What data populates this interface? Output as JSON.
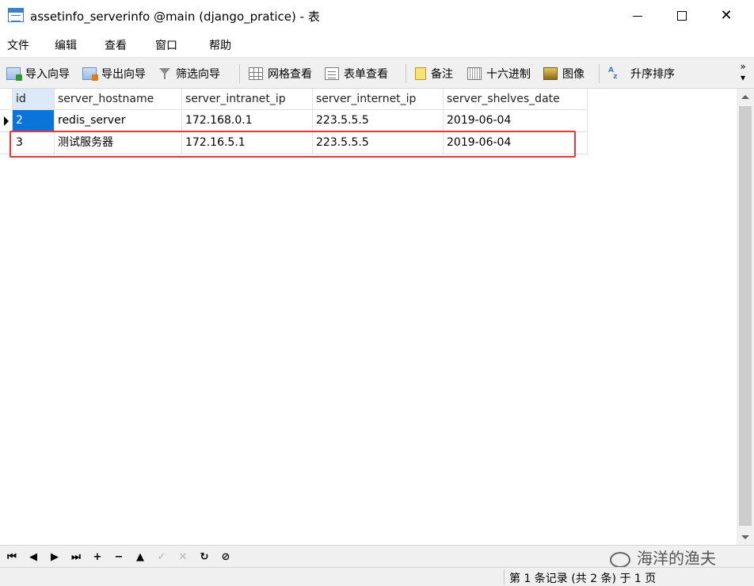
{
  "window": {
    "title": "assetinfo_serverinfo @main (django_pratice) - 表"
  },
  "menu": [
    "文件",
    "编辑",
    "查看",
    "窗口",
    "帮助"
  ],
  "toolbar": {
    "import": "导入向导",
    "export": "导出向导",
    "filter": "筛选向导",
    "grid_view": "网格查看",
    "form_view": "表单查看",
    "note": "备注",
    "hex": "十六进制",
    "image": "图像",
    "sort": "升序排序",
    "more": "»"
  },
  "table": {
    "columns": [
      "id",
      "server_hostname",
      "server_intranet_ip",
      "server_internet_ip",
      "server_shelves_date"
    ],
    "rows": [
      [
        "2",
        "redis_server",
        "172.168.0.1",
        "223.5.5.5",
        "2019-06-04"
      ],
      [
        "3",
        "测试服务器",
        "172.16.5.1",
        "223.5.5.5",
        "2019-06-04"
      ]
    ]
  },
  "navigation": {
    "first": "⏮",
    "prev": "◀",
    "next": "▶",
    "last": "⏭",
    "add": "+",
    "delete": "−",
    "up": "▲",
    "apply": "✓",
    "discard": "✕",
    "refresh": "↻",
    "stop": "⊘"
  },
  "watermark": "海洋的渔夫",
  "status": "第 1 条记录 (共 2 条) 于 1 页",
  "colors": {
    "selection": "#0a74da",
    "highlight_box": "#e0383b"
  }
}
